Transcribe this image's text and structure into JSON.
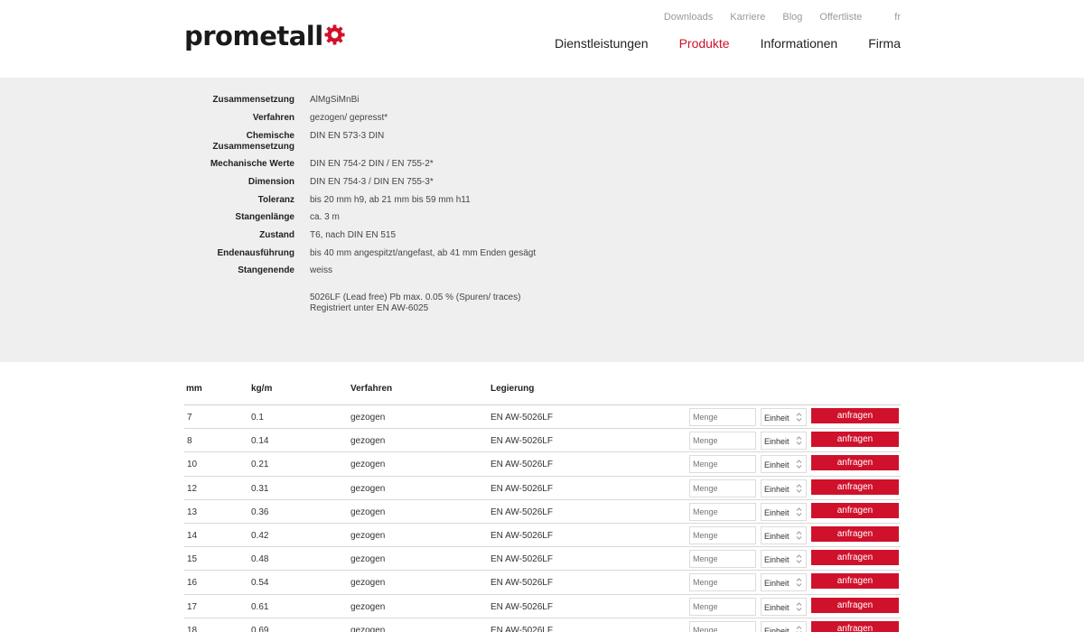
{
  "brand": {
    "name": "prometall",
    "accent": "#d0112b"
  },
  "top_nav": [
    {
      "label": "Downloads"
    },
    {
      "label": "Karriere"
    },
    {
      "label": "Blog"
    },
    {
      "label": "Offertliste"
    },
    {
      "label": "fr"
    }
  ],
  "main_nav": [
    {
      "label": "Dienstleistungen",
      "active": false
    },
    {
      "label": "Produkte",
      "active": true
    },
    {
      "label": "Informationen",
      "active": false
    },
    {
      "label": "Firma",
      "active": false
    }
  ],
  "specs": [
    {
      "label": "Zusammensetzung",
      "value": "AlMgSiMnBi"
    },
    {
      "label": "Verfahren",
      "value": "gezogen/ gepresst*"
    },
    {
      "label": "Chemische Zusammensetzung",
      "value": "DIN EN 573-3 DIN"
    },
    {
      "label": "Mechanische Werte",
      "value": "DIN EN 754-2 DIN / EN 755-2*"
    },
    {
      "label": "Dimension",
      "value": "DIN EN 754-3 / DIN EN 755-3*"
    },
    {
      "label": "Toleranz",
      "value": "bis 20 mm h9, ab 21 mm bis 59 mm h11"
    },
    {
      "label": "Stangenlänge",
      "value": "ca. 3 m"
    },
    {
      "label": "Zustand",
      "value": "T6, nach DIN EN 515"
    },
    {
      "label": "Endenausführung",
      "value": "bis 40 mm angespitzt/angefast, ab 41 mm Enden gesägt"
    },
    {
      "label": "Stangenende",
      "value": "weiss"
    }
  ],
  "spec_note": {
    "line1": "5026LF (Lead free) Pb max. 0.05 % (Spuren/ traces)",
    "line2": "Registriert unter EN AW-6025"
  },
  "table": {
    "headers": {
      "mm": "mm",
      "kg": "kg/m",
      "verfahren": "Verfahren",
      "legierung": "Legierung"
    },
    "menge_placeholder": "Menge",
    "einheit_label": "Einheit",
    "button_label": "anfragen",
    "rows": [
      {
        "mm": "7",
        "kg": "0.1",
        "verfahren": "gezogen",
        "legierung": "EN AW-5026LF"
      },
      {
        "mm": "8",
        "kg": "0.14",
        "verfahren": "gezogen",
        "legierung": "EN AW-5026LF"
      },
      {
        "mm": "10",
        "kg": "0.21",
        "verfahren": "gezogen",
        "legierung": "EN AW-5026LF"
      },
      {
        "mm": "12",
        "kg": "0.31",
        "verfahren": "gezogen",
        "legierung": "EN AW-5026LF"
      },
      {
        "mm": "13",
        "kg": "0.36",
        "verfahren": "gezogen",
        "legierung": "EN AW-5026LF"
      },
      {
        "mm": "14",
        "kg": "0.42",
        "verfahren": "gezogen",
        "legierung": "EN AW-5026LF"
      },
      {
        "mm": "15",
        "kg": "0.48",
        "verfahren": "gezogen",
        "legierung": "EN AW-5026LF"
      },
      {
        "mm": "16",
        "kg": "0.54",
        "verfahren": "gezogen",
        "legierung": "EN AW-5026LF"
      },
      {
        "mm": "17",
        "kg": "0.61",
        "verfahren": "gezogen",
        "legierung": "EN AW-5026LF"
      },
      {
        "mm": "18",
        "kg": "0.69",
        "verfahren": "gezogen",
        "legierung": "EN AW-5026LF"
      }
    ]
  }
}
